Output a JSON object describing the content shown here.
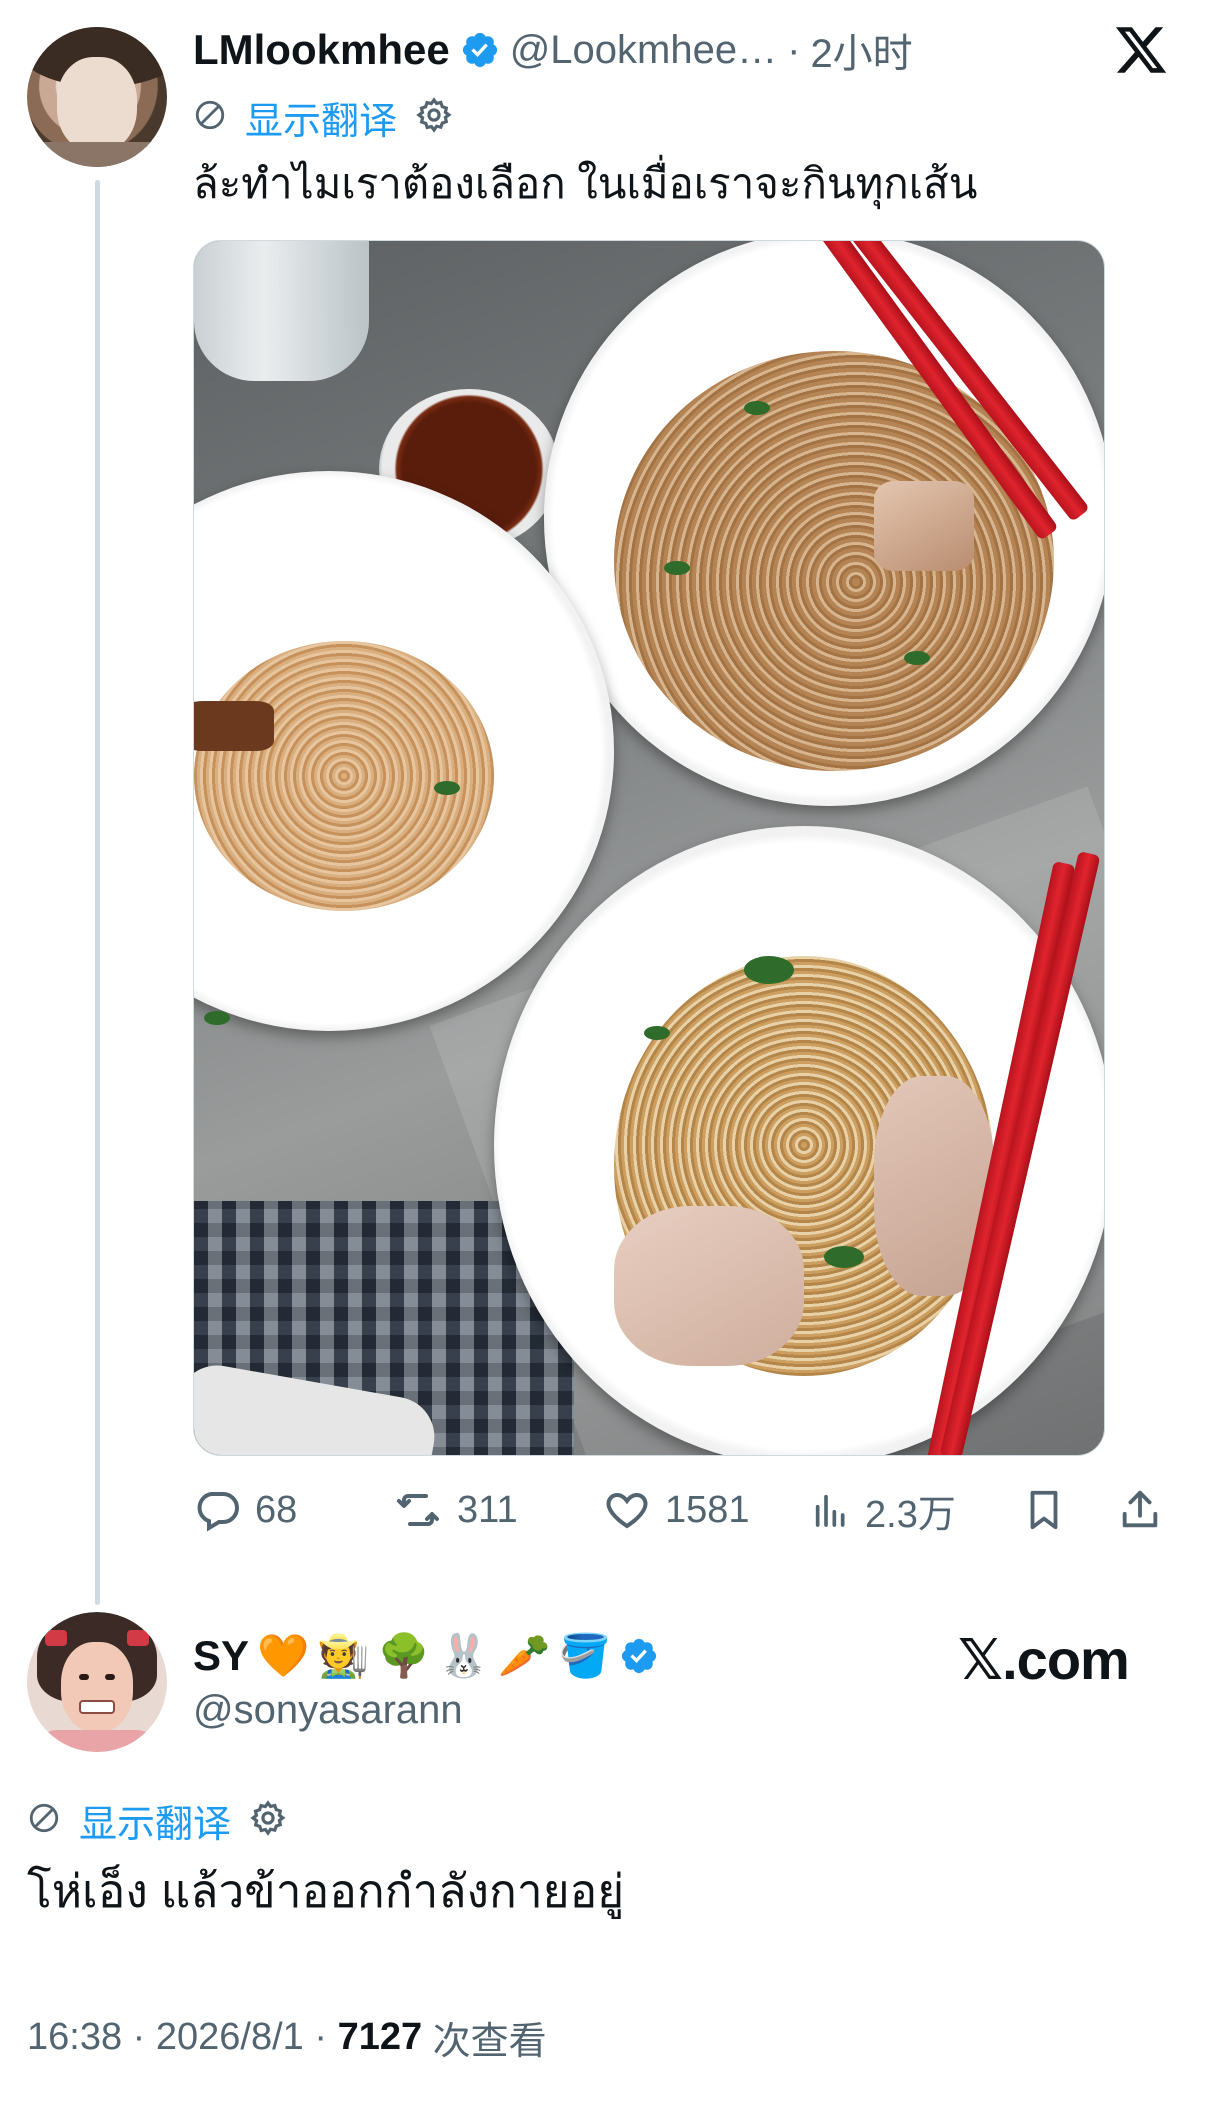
{
  "tweet": {
    "author_name": "LMlookmhee",
    "author_handle": "@Lookmhee…",
    "separator": "·",
    "time_ago": "2小时",
    "translate_label": "显示翻译",
    "text": "ล้ะทำไมเราต้องเลือก ในเมื่อเราจะกินทุกเส้น",
    "stats": {
      "replies": "68",
      "retweets": "311",
      "likes": "1581",
      "views": "2.3万"
    }
  },
  "reply": {
    "author_name": "SY",
    "name_emojis": [
      "🧡",
      "🧑‍🌾",
      "🌳",
      "🐰",
      "🥕",
      "🪣"
    ],
    "author_handle": "@sonyasarann",
    "translate_label": "显示翻译",
    "text": "โห่เอ็ง แล้วข้าออกกำลังกายอยู่",
    "time": "16:38",
    "sep1": " · ",
    "date": "2026/8/1",
    "sep2": " · ",
    "view_count": "7127",
    "view_label": " 次查看"
  },
  "watermark": "𝕏.com",
  "icons": {
    "verified": "verified-badge-icon",
    "translate": "translate-globe-icon",
    "settings": "gear-icon",
    "x_logo": "x-logo-icon",
    "reply": "reply-bubble-icon",
    "retweet": "retweet-icon",
    "like": "heart-icon",
    "views": "views-bar-icon",
    "bookmark": "bookmark-icon",
    "share": "share-icon"
  },
  "colors": {
    "text_primary": "#0f1419",
    "text_secondary": "#536471",
    "accent": "#1d9bf0",
    "thread_line": "#cfd9de"
  }
}
